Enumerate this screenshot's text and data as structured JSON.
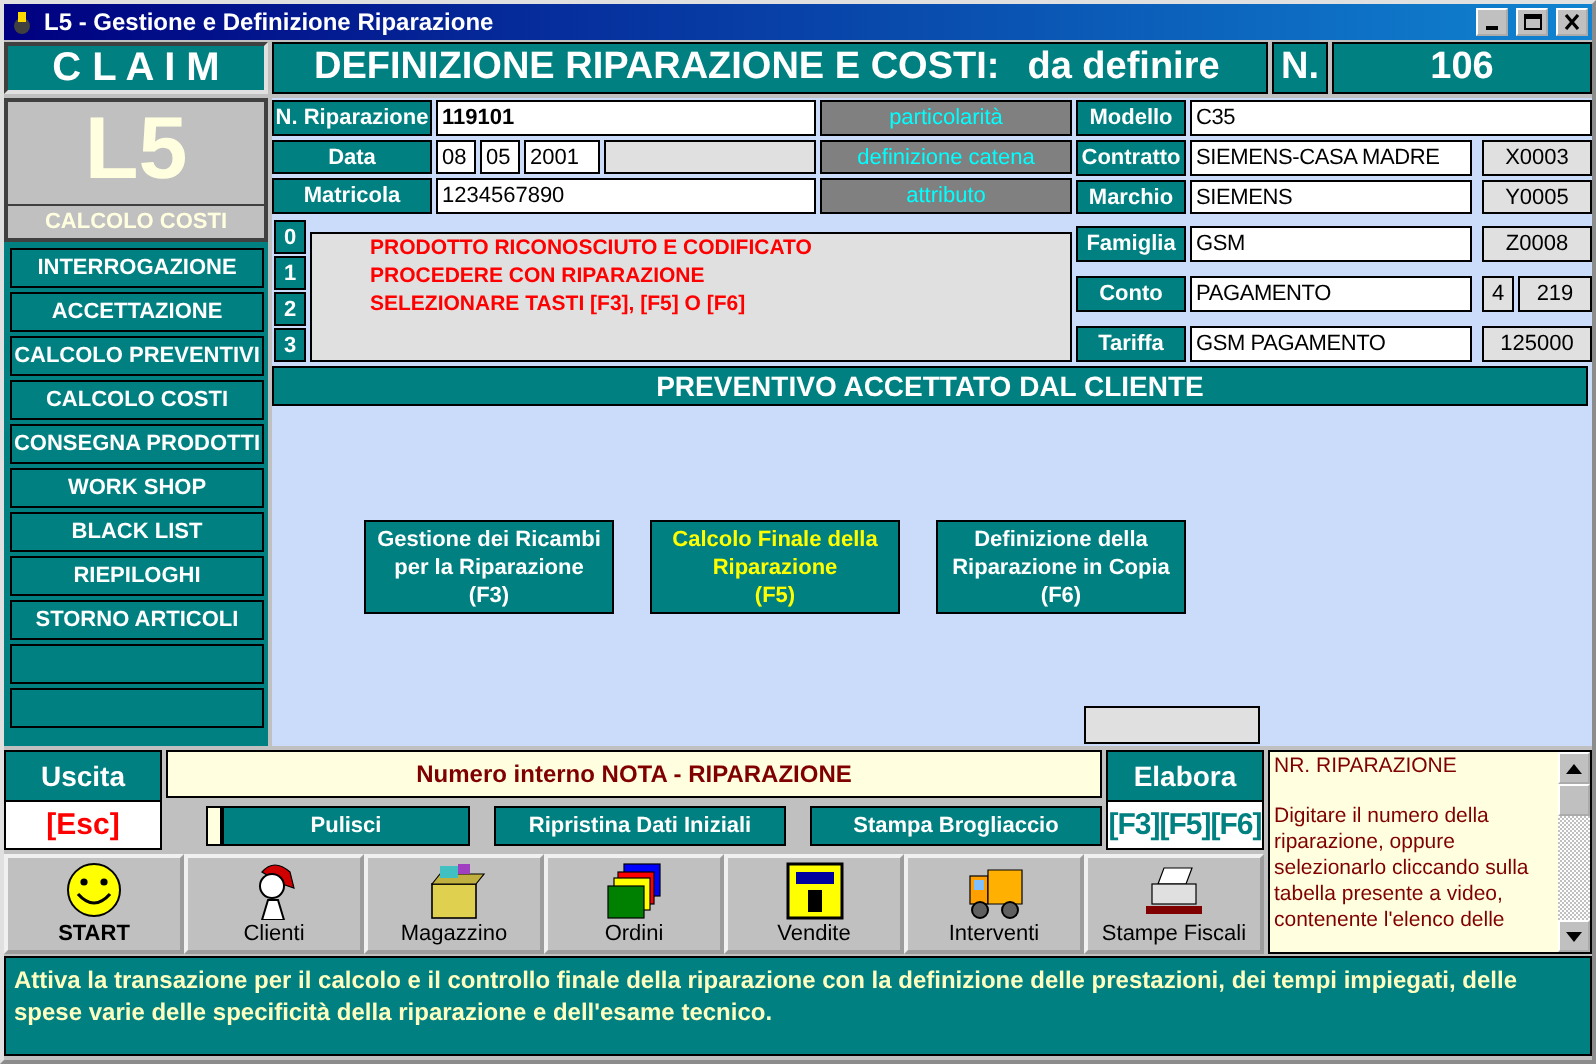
{
  "window": {
    "title": "L5 - Gestione e Definizione Riparazione"
  },
  "header": {
    "brand": "C L A I M",
    "title": "DEFINIZIONE RIPARAZIONE E COSTI:",
    "status": "da definire",
    "number_label": "N.",
    "number": "106"
  },
  "module": {
    "code": "L5",
    "name": "CALCOLO COSTI"
  },
  "menu": [
    {
      "kind": "item",
      "label": "INTERROGAZIONE"
    },
    {
      "kind": "item",
      "label": "ACCETTAZIONE"
    },
    {
      "kind": "item",
      "label": "CALCOLO PREVENTIVI"
    },
    {
      "kind": "item",
      "label": "CALCOLO COSTI"
    },
    {
      "kind": "item",
      "label": "CONSEGNA PRODOTTI"
    },
    {
      "kind": "item",
      "label": "WORK SHOP"
    },
    {
      "kind": "item",
      "label": "BLACK LIST"
    },
    {
      "kind": "item",
      "label": "RIEPILOGHI"
    },
    {
      "kind": "item",
      "label": "STORNO ARTICOLI"
    },
    {
      "kind": "blank"
    },
    {
      "kind": "blank"
    }
  ],
  "form_left": [
    {
      "kind": "main",
      "label": "N. Riparazione",
      "value": "119101",
      "tag": "particolarità"
    },
    {
      "kind": "date",
      "label": "Data",
      "parts": [
        "08",
        "05",
        "2001"
      ],
      "tag": "definizione catena"
    },
    {
      "kind": "text",
      "label": "Matricola",
      "value": "1234567890",
      "tag": "attributo"
    }
  ],
  "form_right": [
    {
      "label": "Modello",
      "value": "C35"
    },
    {
      "label": "Contratto",
      "value": "SIEMENS-CASA MADRE",
      "codes": [
        "X0003"
      ]
    },
    {
      "label": "Marchio",
      "value": "SIEMENS",
      "codes": [
        "Y0005"
      ]
    },
    {
      "label": "Famiglia",
      "value": "GSM",
      "codes": [
        "Z0008"
      ]
    },
    {
      "label": "Conto",
      "value": "PAGAMENTO",
      "codes": [
        "4",
        "219"
      ]
    },
    {
      "label": "Tariffa",
      "value": "GSM PAGAMENTO",
      "codes": [
        "125000"
      ]
    }
  ],
  "messages": {
    "line_numbers": [
      "0",
      "1",
      "2",
      "3"
    ],
    "lines": [
      "PRODOTTO RICONOSCIUTO E CODIFICATO",
      "PROCEDERE CON RIPARAZIONE",
      "SELEZIONARE TASTI [F3], [F5] O [F6]"
    ]
  },
  "banner": "PREVENTIVO ACCETTATO DAL CLIENTE",
  "actions": [
    {
      "label": "Gestione dei Ricambi\nper la Riparazione\n(F3)",
      "highlighted": false
    },
    {
      "label": "Calcolo Finale della\nRiparazione\n(F5)",
      "highlighted": true
    },
    {
      "label": "Definizione della\nRiparazione in Copia\n(F6)",
      "highlighted": false
    }
  ],
  "exit": {
    "label": "Uscita",
    "key": "[Esc]"
  },
  "note": {
    "title": "Numero interno NOTA - RIPARAZIONE",
    "buttons": [
      "Pulisci",
      "Ripristina Dati Iniziali",
      "Stampa Brogliaccio"
    ]
  },
  "process": {
    "label": "Elabora",
    "keys": "[F3][F5][F6]"
  },
  "help": {
    "title": "NR. RIPARAZIONE",
    "body": "Digitare il numero della riparazione, oppure selezionarlo cliccando sulla tabella presente a video, contenente l'elenco delle"
  },
  "toolbar": [
    {
      "label": "START"
    },
    {
      "label": "Clienti"
    },
    {
      "label": "Magazzino"
    },
    {
      "label": "Ordini"
    },
    {
      "label": "Vendite"
    },
    {
      "label": "Interventi"
    },
    {
      "label": "Stampe Fiscali"
    }
  ],
  "status_text": "Attiva la transazione per il calcolo e il controllo finale della  riparazione con la definizione delle prestazioni, dei tempi impiegati, delle spese varie delle specificità della riparazione e dell'esame tecnico."
}
